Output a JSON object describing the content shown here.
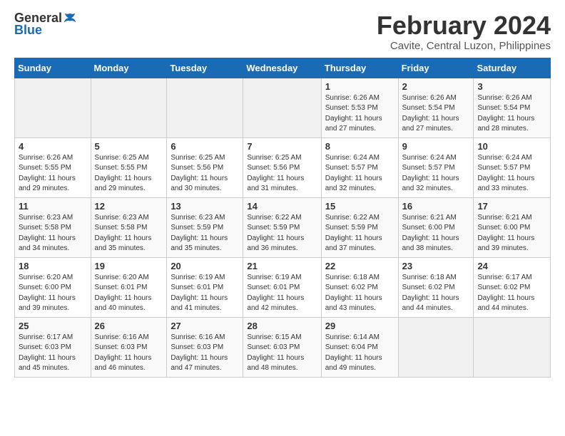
{
  "logo": {
    "general": "General",
    "blue": "Blue"
  },
  "title": "February 2024",
  "subtitle": "Cavite, Central Luzon, Philippines",
  "headers": [
    "Sunday",
    "Monday",
    "Tuesday",
    "Wednesday",
    "Thursday",
    "Friday",
    "Saturday"
  ],
  "weeks": [
    [
      {
        "day": "",
        "info": ""
      },
      {
        "day": "",
        "info": ""
      },
      {
        "day": "",
        "info": ""
      },
      {
        "day": "",
        "info": ""
      },
      {
        "day": "1",
        "info": "Sunrise: 6:26 AM\nSunset: 5:53 PM\nDaylight: 11 hours\nand 27 minutes."
      },
      {
        "day": "2",
        "info": "Sunrise: 6:26 AM\nSunset: 5:54 PM\nDaylight: 11 hours\nand 27 minutes."
      },
      {
        "day": "3",
        "info": "Sunrise: 6:26 AM\nSunset: 5:54 PM\nDaylight: 11 hours\nand 28 minutes."
      }
    ],
    [
      {
        "day": "4",
        "info": "Sunrise: 6:26 AM\nSunset: 5:55 PM\nDaylight: 11 hours\nand 29 minutes."
      },
      {
        "day": "5",
        "info": "Sunrise: 6:25 AM\nSunset: 5:55 PM\nDaylight: 11 hours\nand 29 minutes."
      },
      {
        "day": "6",
        "info": "Sunrise: 6:25 AM\nSunset: 5:56 PM\nDaylight: 11 hours\nand 30 minutes."
      },
      {
        "day": "7",
        "info": "Sunrise: 6:25 AM\nSunset: 5:56 PM\nDaylight: 11 hours\nand 31 minutes."
      },
      {
        "day": "8",
        "info": "Sunrise: 6:24 AM\nSunset: 5:57 PM\nDaylight: 11 hours\nand 32 minutes."
      },
      {
        "day": "9",
        "info": "Sunrise: 6:24 AM\nSunset: 5:57 PM\nDaylight: 11 hours\nand 32 minutes."
      },
      {
        "day": "10",
        "info": "Sunrise: 6:24 AM\nSunset: 5:57 PM\nDaylight: 11 hours\nand 33 minutes."
      }
    ],
    [
      {
        "day": "11",
        "info": "Sunrise: 6:23 AM\nSunset: 5:58 PM\nDaylight: 11 hours\nand 34 minutes."
      },
      {
        "day": "12",
        "info": "Sunrise: 6:23 AM\nSunset: 5:58 PM\nDaylight: 11 hours\nand 35 minutes."
      },
      {
        "day": "13",
        "info": "Sunrise: 6:23 AM\nSunset: 5:59 PM\nDaylight: 11 hours\nand 35 minutes."
      },
      {
        "day": "14",
        "info": "Sunrise: 6:22 AM\nSunset: 5:59 PM\nDaylight: 11 hours\nand 36 minutes."
      },
      {
        "day": "15",
        "info": "Sunrise: 6:22 AM\nSunset: 5:59 PM\nDaylight: 11 hours\nand 37 minutes."
      },
      {
        "day": "16",
        "info": "Sunrise: 6:21 AM\nSunset: 6:00 PM\nDaylight: 11 hours\nand 38 minutes."
      },
      {
        "day": "17",
        "info": "Sunrise: 6:21 AM\nSunset: 6:00 PM\nDaylight: 11 hours\nand 39 minutes."
      }
    ],
    [
      {
        "day": "18",
        "info": "Sunrise: 6:20 AM\nSunset: 6:00 PM\nDaylight: 11 hours\nand 39 minutes."
      },
      {
        "day": "19",
        "info": "Sunrise: 6:20 AM\nSunset: 6:01 PM\nDaylight: 11 hours\nand 40 minutes."
      },
      {
        "day": "20",
        "info": "Sunrise: 6:19 AM\nSunset: 6:01 PM\nDaylight: 11 hours\nand 41 minutes."
      },
      {
        "day": "21",
        "info": "Sunrise: 6:19 AM\nSunset: 6:01 PM\nDaylight: 11 hours\nand 42 minutes."
      },
      {
        "day": "22",
        "info": "Sunrise: 6:18 AM\nSunset: 6:02 PM\nDaylight: 11 hours\nand 43 minutes."
      },
      {
        "day": "23",
        "info": "Sunrise: 6:18 AM\nSunset: 6:02 PM\nDaylight: 11 hours\nand 44 minutes."
      },
      {
        "day": "24",
        "info": "Sunrise: 6:17 AM\nSunset: 6:02 PM\nDaylight: 11 hours\nand 44 minutes."
      }
    ],
    [
      {
        "day": "25",
        "info": "Sunrise: 6:17 AM\nSunset: 6:03 PM\nDaylight: 11 hours\nand 45 minutes."
      },
      {
        "day": "26",
        "info": "Sunrise: 6:16 AM\nSunset: 6:03 PM\nDaylight: 11 hours\nand 46 minutes."
      },
      {
        "day": "27",
        "info": "Sunrise: 6:16 AM\nSunset: 6:03 PM\nDaylight: 11 hours\nand 47 minutes."
      },
      {
        "day": "28",
        "info": "Sunrise: 6:15 AM\nSunset: 6:03 PM\nDaylight: 11 hours\nand 48 minutes."
      },
      {
        "day": "29",
        "info": "Sunrise: 6:14 AM\nSunset: 6:04 PM\nDaylight: 11 hours\nand 49 minutes."
      },
      {
        "day": "",
        "info": ""
      },
      {
        "day": "",
        "info": ""
      }
    ]
  ]
}
